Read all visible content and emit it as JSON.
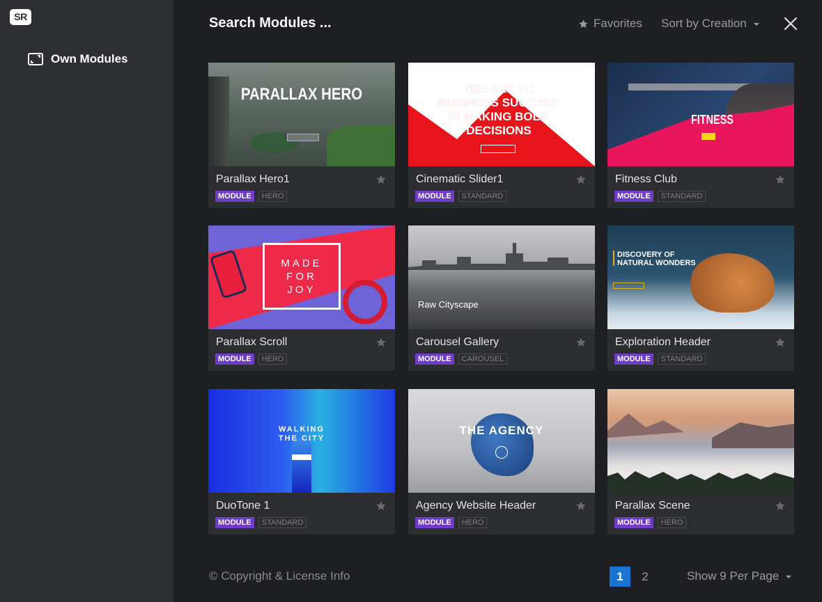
{
  "sidebar": {
    "logo": "SR",
    "items": [
      {
        "label": "Own Modules",
        "icon": "image-frame-icon"
      }
    ]
  },
  "header": {
    "title": "Search Modules ...",
    "favorites_label": "Favorites",
    "sort_label": "Sort by Creation"
  },
  "cards": [
    {
      "title": "Parallax Hero1",
      "type": "MODULE",
      "category": "HERO",
      "thumb_text": "PARALLAX HERO"
    },
    {
      "title": "Cinematic Slider1",
      "type": "MODULE",
      "category": "STANDARD",
      "thumb_text": "THE KEY TO BUSINESS SUCCESS IS MAKING BOLD DECISIONS"
    },
    {
      "title": "Fitness Club",
      "type": "MODULE",
      "category": "STANDARD",
      "thumb_text": "FITNESS"
    },
    {
      "title": "Parallax Scroll",
      "type": "MODULE",
      "category": "HERO",
      "thumb_text": "MADE FOR JOY"
    },
    {
      "title": "Carousel Gallery",
      "type": "MODULE",
      "category": "CAROUSEL",
      "thumb_text": "Raw Cityscape"
    },
    {
      "title": "Exploration Header",
      "type": "MODULE",
      "category": "STANDARD",
      "thumb_text": "DISCOVERY OF NATURAL WONDERS"
    },
    {
      "title": "DuoTone 1",
      "type": "MODULE",
      "category": "STANDARD",
      "thumb_text": "WALKING THE CITY"
    },
    {
      "title": "Agency Website Header",
      "type": "MODULE",
      "category": "HERO",
      "thumb_text": "THE AGENCY"
    },
    {
      "title": "Parallax Scene",
      "type": "MODULE",
      "category": "HERO",
      "thumb_text": ""
    }
  ],
  "footer": {
    "copyright": "© Copyright & License Info",
    "pages": [
      "1",
      "2"
    ],
    "current_page": "1",
    "per_page_label": "Show 9 Per Page"
  },
  "colors": {
    "accent": "#1a72d1",
    "module_tag": "#6e3cc7",
    "sidebar_bg": "#2e2f33",
    "main_bg": "#1e1f22"
  }
}
